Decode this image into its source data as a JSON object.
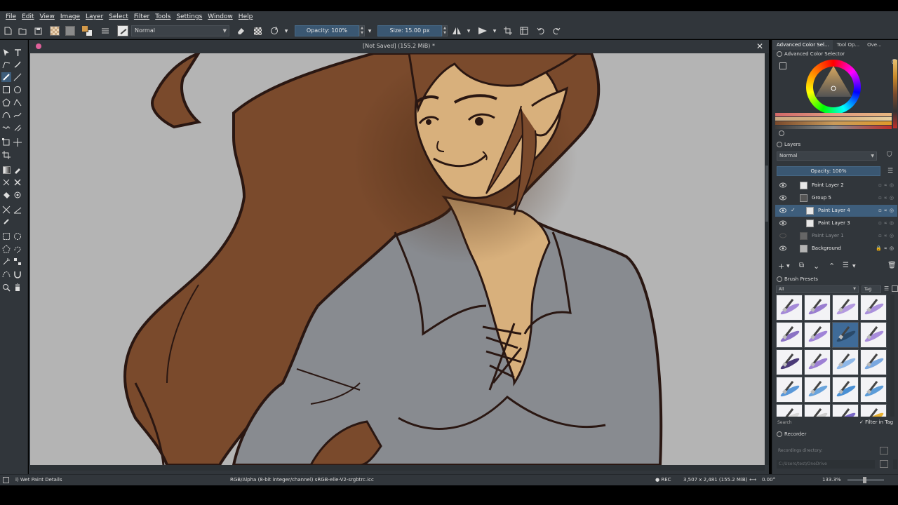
{
  "menubar": {
    "items": [
      "File",
      "Edit",
      "View",
      "Image",
      "Layer",
      "Select",
      "Filter",
      "Tools",
      "Settings",
      "Window",
      "Help"
    ]
  },
  "toolbar": {
    "blend_mode": "Normal",
    "opacity_label": "Opacity: 100%",
    "size_label": "Size: 15.00 px"
  },
  "document": {
    "title": "[Not Saved]  (155.2 MiB) *",
    "close_glyph": "✕"
  },
  "dock": {
    "tabs": [
      "Advanced Color Sel...",
      "Tool Op...",
      "Ove..."
    ],
    "color_selector_title": "Advanced Color Selector",
    "layers_title": "Layers",
    "layer_blend_mode": "Normal",
    "layer_opacity_label": "Opacity:  100%",
    "layers": [
      {
        "name": "Paint Layer 2",
        "visible": true,
        "active": false,
        "dim": false
      },
      {
        "name": "Group 5",
        "visible": true,
        "active": false,
        "dim": false
      },
      {
        "name": "Paint Layer 4",
        "visible": true,
        "active": true,
        "dim": false
      },
      {
        "name": "Paint Layer 3",
        "visible": true,
        "active": false,
        "dim": false
      },
      {
        "name": "Paint Layer 1",
        "visible": false,
        "active": false,
        "dim": true
      },
      {
        "name": "Background",
        "visible": true,
        "active": false,
        "dim": false
      }
    ],
    "brush_presets_title": "Brush Presets",
    "preset_filter": "All",
    "preset_tag": "Tag",
    "search_label": "Search",
    "filter_in_tag": "Filter in Tag",
    "recorder_title": "Recorder",
    "recordings_directory_label": "Recordings directory:",
    "recordings_directory_value": "C:/Users/test/OneDrive"
  },
  "statusbar": {
    "brush_name": "i) Wet Paint Details",
    "color_profile": "RGB/Alpha (8-bit integer/channel)  sRGB-elle-V2-srgbtrc.icc",
    "rec_label": "REC",
    "dimensions": "3,507 x 2,481 (155.2 MiB)",
    "rotation": "0.00°",
    "zoom": "133.3%"
  },
  "colors": {
    "ui_bg": "#31363b",
    "accent": "#3e5e7c",
    "canvas_bg": "#b4b4b4",
    "hair": "#7a4a2c",
    "skin": "#d8b07c",
    "shirt": "#888b90",
    "lineart": "#2a1712"
  },
  "icons": {
    "eye": "eye-icon",
    "lock": "lock-icon",
    "add": "add-layer-icon",
    "delete": "trash-icon"
  }
}
